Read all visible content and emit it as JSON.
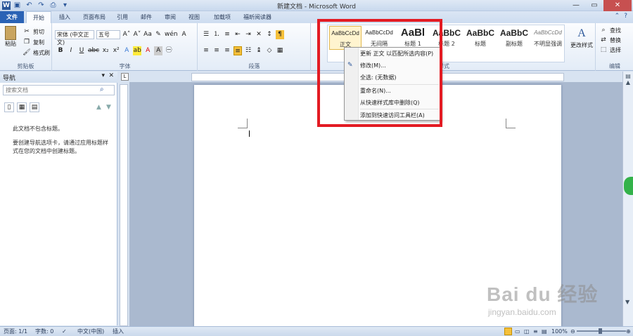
{
  "window": {
    "title": "新建文档 - Microsoft Word",
    "app_icon": "W"
  },
  "qat": [
    "save-icon",
    "undo-icon",
    "redo-icon",
    "print-icon",
    "customize-icon"
  ],
  "tabs": [
    "文件",
    "开始",
    "插入",
    "页面布局",
    "引用",
    "邮件",
    "审阅",
    "视图",
    "加载项",
    "福昕阅读器"
  ],
  "ribbon": {
    "clipboard": {
      "paste": "粘贴",
      "cut": "剪切",
      "copy": "复制",
      "format_painter": "格式刷",
      "label": "剪贴板"
    },
    "font": {
      "font_name": "宋体 (中文正文)",
      "font_size": "五号",
      "label": "字体"
    },
    "paragraph": {
      "label": "段落"
    },
    "styles": {
      "label": "样式",
      "change_styles": "更改样式",
      "tiles": [
        {
          "sample": "AaBbCcDd",
          "name": "正文"
        },
        {
          "sample": "AaBbCcDd",
          "name": "无间隔"
        },
        {
          "sample": "AaBl",
          "name": "标题 1"
        },
        {
          "sample": "AaBbC",
          "name": "标题 2"
        },
        {
          "sample": "AaBbC",
          "name": "标题"
        },
        {
          "sample": "AaBbC",
          "name": "副标题"
        },
        {
          "sample": "AaBbCcDd",
          "name": "不明显强调"
        }
      ]
    },
    "editing": {
      "find": "查找",
      "replace": "替换",
      "select": "选择",
      "label": "编辑"
    }
  },
  "context_menu": [
    "更新 正文 以匹配所选内容(P)",
    "修改(M)...",
    "全选: (无数据)",
    "重命名(N)...",
    "从快速样式库中删除(Q)",
    "添加到快速访问工具栏(A)"
  ],
  "nav": {
    "title": "导航",
    "search_placeholder": "搜索文档",
    "message1": "此文档不包含标题。",
    "message2": "要创建导航选项卡，请通过应用标题样式在您的文档中创建标题。"
  },
  "status": {
    "page": "页面: 1/1",
    "words": "字数: 0",
    "language": "中文(中国)",
    "mode": "插入",
    "zoom": "100%"
  },
  "watermark": {
    "logo": "Bai du 经验",
    "url": "jingyan.baidu.com"
  },
  "colors": {
    "file_tab": "#2a62b5",
    "highlight": "#e31b23",
    "status_green": "#33b24a"
  }
}
